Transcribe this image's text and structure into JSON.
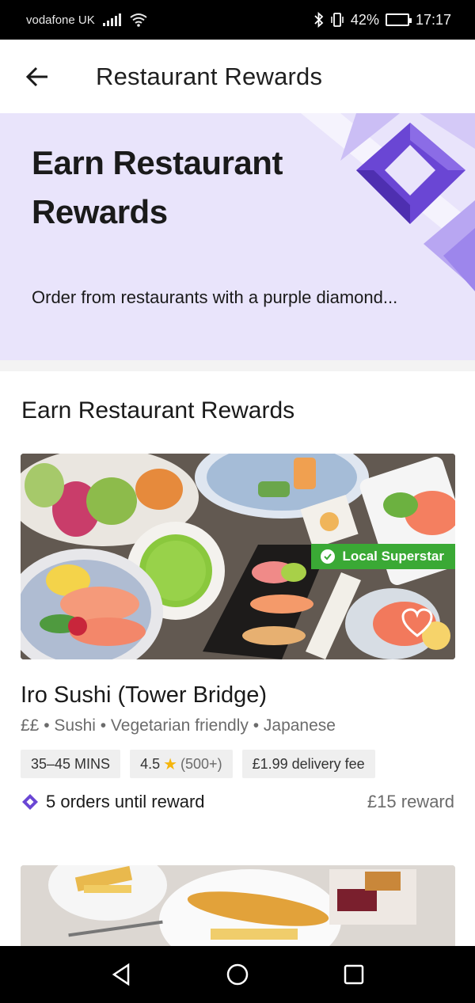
{
  "status": {
    "carrier": "vodafone UK",
    "battery": "42%",
    "battery_level": 0.42,
    "time": "17:17"
  },
  "header": {
    "title": "Restaurant Rewards"
  },
  "hero": {
    "title": "Earn Restaurant Rewards",
    "subtitle": "Order from restaurants with a purple diamond..."
  },
  "section": {
    "title": "Earn Restaurant Rewards"
  },
  "restaurant": {
    "badge": "Local Superstar",
    "name": "Iro Sushi (Tower Bridge)",
    "tags": "££ • Sushi • Vegetarian friendly • Japanese",
    "delivery_time": "35–45 MINS",
    "rating": "4.5",
    "rating_count": "(500+)",
    "delivery_fee": "£1.99 delivery fee",
    "orders_until_reward": "5 orders until reward",
    "reward": "£15 reward"
  },
  "colors": {
    "accent_purple": "#6a46d4",
    "hero_bg": "#e9e4fb",
    "superstar_green": "#3aa935",
    "star": "#f5b50c"
  }
}
